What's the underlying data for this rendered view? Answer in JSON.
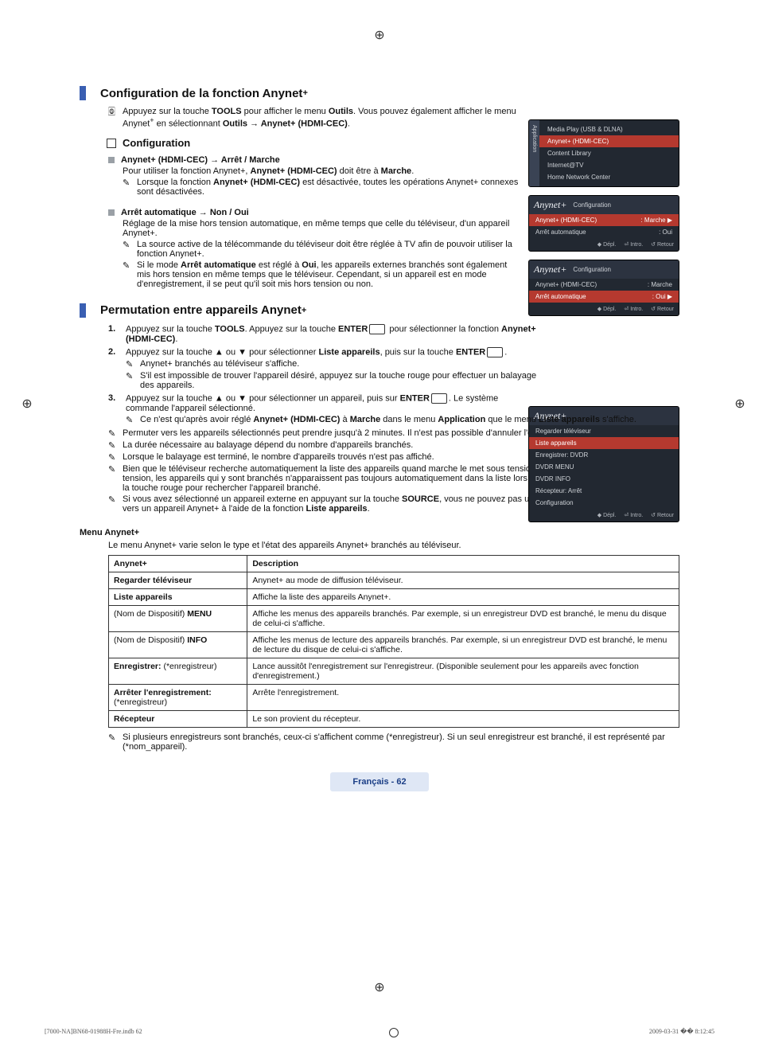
{
  "headings": {
    "h_config": "Configuration de la fonction Anynet",
    "h_perm": "Permutation entre appareils Anynet",
    "plus": "+"
  },
  "intro": {
    "tools_line_a": "Appuyez sur la touche ",
    "tools_b": "TOOLS",
    "tools_line_b": " pour afficher le menu ",
    "outils_b": "Outils",
    "tools_line_c": ". Vous pouvez également afficher le menu Anynet",
    "tools_line_d": " en sélectionnant ",
    "path": "Outils → Anynet+ (HDMI-CEC)",
    "dot": "."
  },
  "config": {
    "title": "Configuration",
    "a_title": "Anynet+ (HDMI-CEC) → Arrêt / Marche",
    "a_body": "Pour utiliser la fonction Anynet+, ",
    "a_bold": "Anynet+ (HDMI-CEC)",
    "a_body2": " doit être à ",
    "a_bold2": "Marche",
    "a_note": "Lorsque la fonction ",
    "a_note2": " est désactivée, toutes les opérations Anynet+ connexes sont désactivées.",
    "b_title": "Arrêt automatique → Non / Oui",
    "b_body": "Réglage de la mise hors tension automatique, en même temps que celle du téléviseur, d'un appareil Anynet+.",
    "b_n1": "La source active de la télécommande du téléviseur doit être réglée à TV afin de pouvoir utiliser la fonction Anynet+.",
    "b_n2a": "Si le mode ",
    "b_n2b": "Arrêt automatique",
    "b_n2c": " est réglé à ",
    "b_n2d": "Oui",
    "b_n2e": ", les appareils externes branchés sont également mis hors tension en même temps que le téléviseur. Cependant, si un appareil est en mode d'enregistrement, il se peut qu'il soit mis hors tension ou non."
  },
  "perm": {
    "s1a": "Appuyez sur la touche ",
    "s1b": "TOOLS",
    "s1c": ". Appuyez sur la touche ",
    "s1d": "ENTER",
    "s1e": " pour sélectionner la fonction ",
    "s1f": "Anynet+ (HDMI-CEC)",
    "s2a": "Appuyez sur la touche ▲ ou ▼ pour sélectionner ",
    "s2b": "Liste appareils",
    "s2c": ", puis sur la touche ",
    "s2d": "ENTER",
    "s2n1": "Anynet+ branchés au téléviseur s'affiche.",
    "s2n2": "S'il est impossible de trouver l'appareil désiré, appuyez sur la touche rouge pour effectuer un balayage des appareils.",
    "s3a": "Appuyez sur la touche ▲ ou ▼ pour sélectionner un appareil, puis sur ",
    "s3b": "ENTER",
    "s3c": ". Le système commande l'appareil sélectionné.",
    "s3n1a": "Ce n'est qu'après avoir réglé ",
    "s3n1b": "Anynet+ (HDMI-CEC)",
    "s3n1c": " à ",
    "s3n1d": "Marche",
    "s3n1e": " dans le menu ",
    "s3n1f": "Application",
    "s3n1g": " que le menu ",
    "s3n1h": "Liste appareils",
    "s3n1i": " s'affiche.",
    "n_a": "Permuter vers les appareils sélectionnés peut prendre jusqu'à 2 minutes. Il n'est pas possible d'annuler l'opération de permutation.",
    "n_b": "La durée nécessaire au balayage dépend du nombre d'appareils branchés.",
    "n_c": "Lorsque le balayage est terminé, le nombre d'appareils trouvés n'est pas affiché.",
    "n_d": "Bien que le téléviseur recherche automatiquement la liste des appareils quand marche le met sous tension à l'aide la touche de mise sous tension, les appareils qui y sont branchés n'apparaissent pas toujours automatiquement dans la liste lors de sa mise sous tension. Appuyez sur la touche rouge pour rechercher l'appareil branché.",
    "n_e_a": "Si vous avez sélectionné un appareil externe en appuyant sur la touche ",
    "n_e_b": "SOURCE",
    "n_e_c": ", vous ne pouvez pas utiliser la fonction Anynet+. Permutez vers un appareil Anynet+ à l'aide de la fonction ",
    "n_e_d": "Liste appareils"
  },
  "menu": {
    "title": "Menu Anynet+",
    "desc": "Le menu Anynet+ varie selon le type et l'état des appareils Anynet+ branchés au téléviseur.",
    "col1": "Anynet+",
    "col2": "Description",
    "rows": [
      {
        "a": "Regarder téléviseur",
        "b": "Anynet+ au mode de diffusion téléviseur."
      },
      {
        "a": "Liste appareils",
        "b": "Affiche la liste des appareils Anynet+."
      },
      {
        "a": "(Nom de Dispositif) MENU",
        "b": "Affiche les menus des appareils branchés. Par exemple, si un enregistreur DVD est branché, le menu du disque de celui-ci s'affiche."
      },
      {
        "a": "(Nom de Dispositif) INFO",
        "b": "Affiche les menus de lecture des appareils branchés. Par exemple, si un enregistreur DVD est branché, le menu de lecture du disque de celui-ci s'affiche."
      },
      {
        "a": "Enregistrer: (*enregistreur)",
        "b": "Lance aussitôt l'enregistrement sur l'enregistreur. (Disponible seulement pour les appareils avec fonction d'enregistrement.)"
      },
      {
        "a": "Arrêter l'enregistrement: (*enregistreur)",
        "b": "Arrête l'enregistrement."
      },
      {
        "a": "Récepteur",
        "b": "Le son provient du récepteur."
      }
    ],
    "foot": "Si plusieurs enregistreurs sont branchés, ceux-ci s'affichent comme (*enregistreur). Si un seul enregistreur est branché, il est représenté par (*nom_appareil)."
  },
  "shot1": {
    "tab": "Application",
    "items": [
      "Media Play (USB & DLNA)",
      "Anynet+ (HDMI-CEC)",
      "Content Library",
      "Internet@TV",
      "Home Network Center"
    ]
  },
  "shot23": {
    "logo": "Anynet+",
    "title": "Configuration",
    "r1": "Anynet+ (HDMI-CEC)",
    "v1": ": Marche",
    "r2": "Arrêt automatique",
    "v2": ": Oui",
    "f1": "Dépl.",
    "f2": "Intro.",
    "f3": "Retour"
  },
  "shot4": {
    "logo": "Anynet+",
    "items": [
      "Regarder téléviseur",
      "Liste appareils",
      "Enregistrer: DVDR",
      "DVDR MENU",
      "DVDR INFO",
      "Récepteur: Arrêt",
      "Configuration"
    ],
    "f1": "Dépl.",
    "f2": "Intro.",
    "f3": "Retour"
  },
  "footer": {
    "page": "Français - 62",
    "file": "[7000-NA]BN68-01988H-Fre.indb   62",
    "date": "2009-03-31   �� 8:12:45"
  },
  "icons": {
    "note": "✎",
    "info": "ℹ",
    "tool": "🀙",
    "arrow": "▶",
    "back": "↺",
    "enter": "⏎",
    "diamond": "◆"
  }
}
